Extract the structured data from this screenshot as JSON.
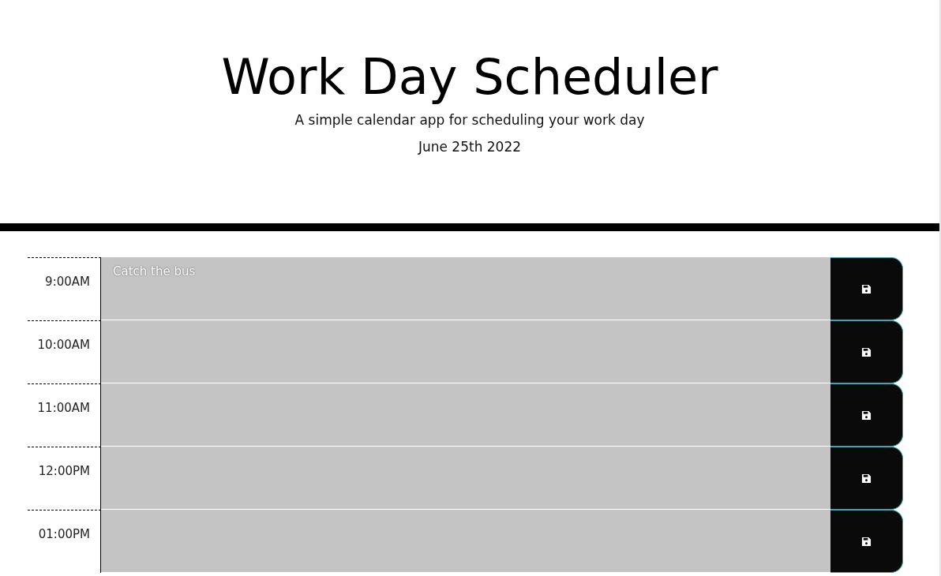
{
  "header": {
    "title": "Work Day Scheduler",
    "subtitle": "A simple calendar app for scheduling your work day",
    "date": "June 25th 2022"
  },
  "rows": [
    {
      "hour": "9:00AM",
      "value": "Catch the bus"
    },
    {
      "hour": "10:00AM",
      "value": ""
    },
    {
      "hour": "11:00AM",
      "value": ""
    },
    {
      "hour": "12:00PM",
      "value": ""
    },
    {
      "hour": "01:00PM",
      "value": ""
    }
  ]
}
